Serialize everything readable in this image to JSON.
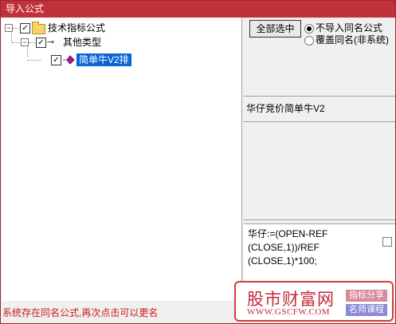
{
  "window": {
    "title": "导入公式"
  },
  "tree": {
    "root": {
      "label": "技术指标公式",
      "checked": true,
      "expanded": true
    },
    "group": {
      "label": "其他类型",
      "checked": true,
      "expanded": true
    },
    "item": {
      "label": "简单牛V2排",
      "checked": true,
      "selected": true
    }
  },
  "options": {
    "select_all_label": "全部选中",
    "radio_skip_label": "不导入同名公式",
    "radio_overwrite_label": "覆盖同名(非系统)",
    "selected_option": "skip"
  },
  "detail": {
    "formula_name": "华仔竞价简单牛V2",
    "code_line1": "华仔:=(OPEN-REF",
    "code_line2": "(CLOSE,1))/REF",
    "code_line3": "(CLOSE,1)*100;"
  },
  "status": {
    "message": "系统存在同名公式,再次点击可以更名"
  },
  "watermark": {
    "title": "股市财富网",
    "url": "WWW.GSCFW.COM",
    "tag1": "指标分享",
    "tag2": "名师课程"
  },
  "colors": {
    "titlebar": "#c0323a",
    "selection": "#0a64d6",
    "status_text": "#d01818",
    "watermark_red": "#c42a3a"
  }
}
